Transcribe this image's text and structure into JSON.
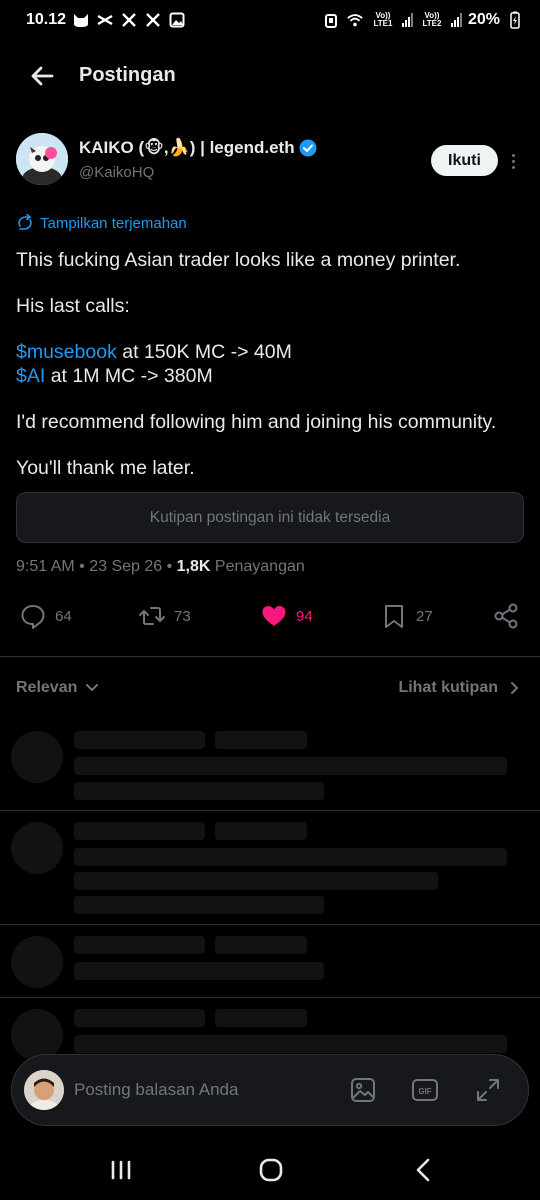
{
  "status_bar": {
    "time": "10.12",
    "network1": "Vo)) LTE1",
    "network2": "Vo)) LTE2",
    "battery": "20%"
  },
  "header": {
    "title": "Postingan"
  },
  "author": {
    "name": "KAIKO (🐵,🍌) | legend.eth",
    "handle": "@KaikoHQ",
    "follow_label": "Ikuti"
  },
  "translate_label": "Tampilkan terjemahan",
  "tweet": {
    "line1": "This fucking Asian trader looks like a money printer.",
    "line2": "His last calls:",
    "call1_tag": "$musebook",
    "call1_text": " at 150K MC -> 40M",
    "call2_tag": "$AI",
    "call2_text": " at 1M MC -> 380M",
    "line4": "I'd recommend following him and joining his community.",
    "line5": "You'll thank me later."
  },
  "quote_unavailable": "Kutipan postingan ini tidak tersedia",
  "meta": {
    "time": "9:51 AM",
    "date": "23 Sep 26",
    "views": "1,8K",
    "views_label": "Penayangan"
  },
  "actions": {
    "replies": "64",
    "reposts": "73",
    "likes": "94",
    "bookmarks": "27"
  },
  "sort": {
    "left_label": "Relevan",
    "right_label": "Lihat kutipan"
  },
  "reply_bar": {
    "placeholder": "Posting balasan Anda"
  },
  "colors": {
    "accent": "#1d9bf0",
    "like": "#f91880",
    "muted": "#71767b",
    "background": "#000000"
  }
}
